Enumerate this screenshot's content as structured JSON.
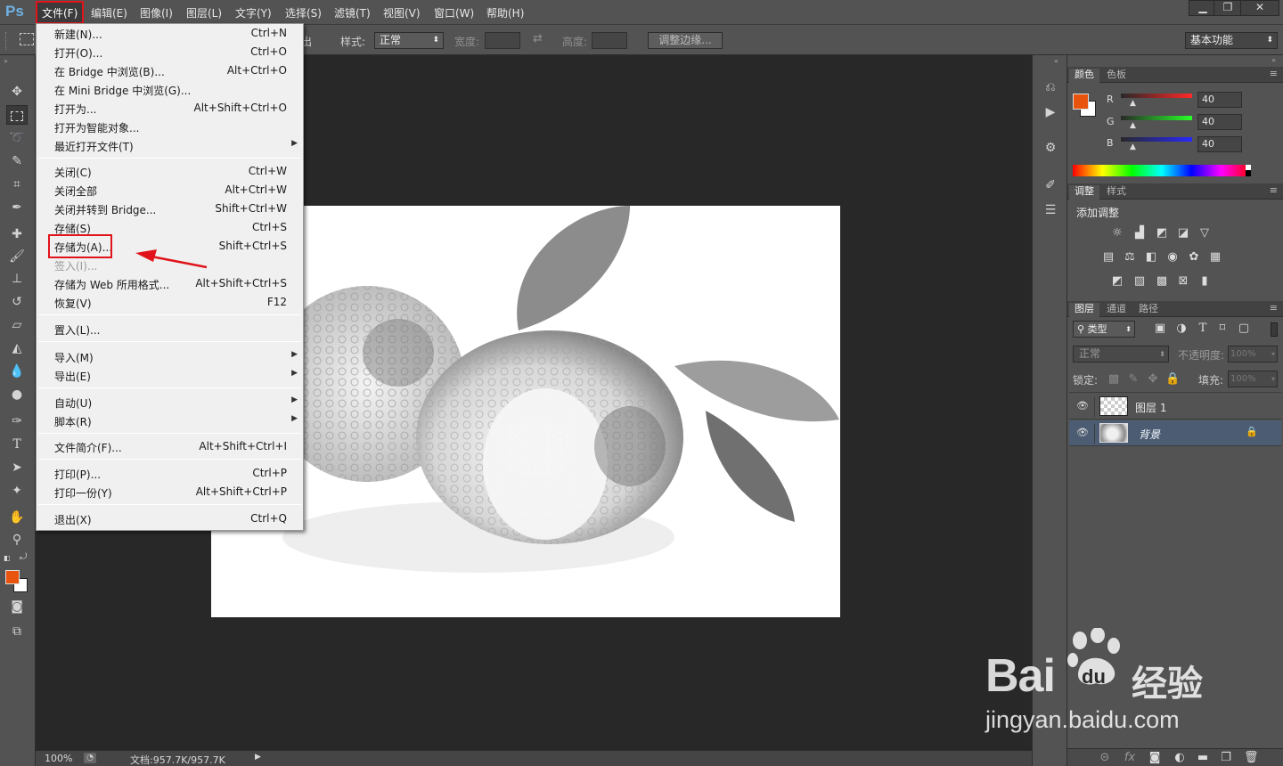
{
  "app": {
    "logo": "Ps",
    "menus": [
      "文件(F)",
      "编辑(E)",
      "图像(I)",
      "图层(L)",
      "文字(Y)",
      "选择(S)",
      "滤镜(T)",
      "视图(V)",
      "窗口(W)",
      "帮助(H)"
    ]
  },
  "window_controls": [
    "▁",
    "❐",
    "✕"
  ],
  "options_bar": {
    "feather_label_partial": "消除锯齿",
    "style_label": "样式:",
    "style_value": "正常",
    "width_label": "宽度:",
    "height_label": "高度:",
    "refine_edge_button": "调整边缘...",
    "workspace": "基本功能"
  },
  "file_menu": {
    "items": [
      {
        "label": "新建(N)...",
        "shortcut": "Ctrl+N"
      },
      {
        "label": "打开(O)...",
        "shortcut": "Ctrl+O"
      },
      {
        "label": "在 Bridge 中浏览(B)...",
        "shortcut": "Alt+Ctrl+O"
      },
      {
        "label": "在 Mini Bridge 中浏览(G)...",
        "shortcut": ""
      },
      {
        "label": "打开为...",
        "shortcut": "Alt+Shift+Ctrl+O"
      },
      {
        "label": "打开为智能对象...",
        "shortcut": ""
      },
      {
        "label": "最近打开文件(T)",
        "shortcut": "",
        "submenu": true
      },
      {
        "label": "关闭(C)",
        "shortcut": "Ctrl+W"
      },
      {
        "label": "关闭全部",
        "shortcut": "Alt+Ctrl+W"
      },
      {
        "label": "关闭并转到 Bridge...",
        "shortcut": "Shift+Ctrl+W"
      },
      {
        "label": "存储(S)",
        "shortcut": "Ctrl+S"
      },
      {
        "label": "存储为(A)...",
        "shortcut": "Shift+Ctrl+S",
        "highlighted": true
      },
      {
        "label": "签入(I)...",
        "shortcut": "",
        "disabled": true
      },
      {
        "label": "存储为 Web 所用格式...",
        "shortcut": "Alt+Shift+Ctrl+S"
      },
      {
        "label": "恢复(V)",
        "shortcut": "F12"
      },
      {
        "label": "置入(L)...",
        "shortcut": ""
      },
      {
        "label": "导入(M)",
        "shortcut": "",
        "submenu": true
      },
      {
        "label": "导出(E)",
        "shortcut": "",
        "submenu": true
      },
      {
        "label": "自动(U)",
        "shortcut": "",
        "submenu": true
      },
      {
        "label": "脚本(R)",
        "shortcut": "",
        "submenu": true
      },
      {
        "label": "文件简介(F)...",
        "shortcut": "Alt+Shift+Ctrl+I"
      },
      {
        "label": "打印(P)...",
        "shortcut": "Ctrl+P"
      },
      {
        "label": "打印一份(Y)",
        "shortcut": "Alt+Shift+Ctrl+P"
      },
      {
        "label": "退出(X)",
        "shortcut": "Ctrl+Q"
      }
    ]
  },
  "color_panel": {
    "tabs": [
      "颜色",
      "色板"
    ],
    "foreground": "#e8540e",
    "background": "#ffffff",
    "channels": [
      {
        "name": "R",
        "value": "40"
      },
      {
        "name": "G",
        "value": "40"
      },
      {
        "name": "B",
        "value": "40"
      }
    ]
  },
  "adjustments_panel": {
    "tabs": [
      "调整",
      "样式"
    ],
    "title": "添加调整"
  },
  "layers_panel": {
    "tabs": [
      "图层",
      "通道",
      "路径"
    ],
    "filter": "类型",
    "blend_mode": "正常",
    "opacity_label": "不透明度:",
    "opacity_value": "100%",
    "lock_label": "锁定:",
    "fill_label": "填充:",
    "fill_value": "100%",
    "layers": [
      {
        "name": "图层 1",
        "selected": false,
        "locked": false
      },
      {
        "name": "背景",
        "selected": true,
        "locked": true
      }
    ]
  },
  "status_bar": {
    "zoom": "100%",
    "doc_info": "文档:957.7K/957.7K"
  },
  "watermark": {
    "brand": "Bai",
    "brand2": "du",
    "service": "经验",
    "url": "jingyan.baidu.com"
  }
}
